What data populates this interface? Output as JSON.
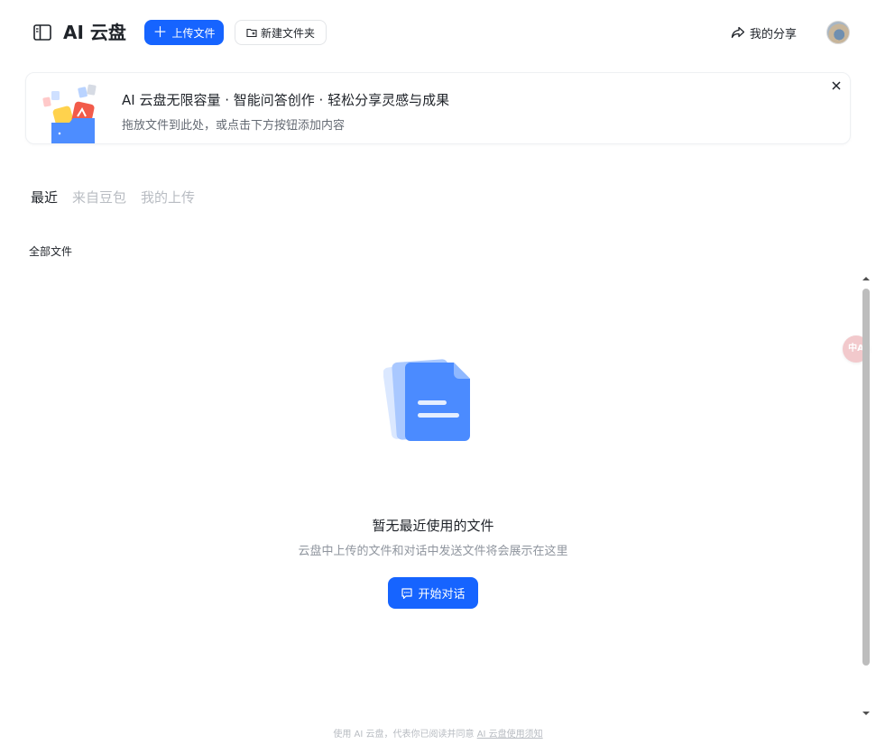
{
  "header": {
    "app_title": "AI 云盘",
    "upload_label": "上传文件",
    "new_folder_label": "新建文件夹",
    "share_label": "我的分享"
  },
  "banner": {
    "title": "AI 云盘无限容量 · 智能问答创作 · 轻松分享灵感与成果",
    "subtitle": "拖放文件到此处，或点击下方按钮添加内容"
  },
  "tabs": [
    {
      "label": "最近",
      "active": true
    },
    {
      "label": "来自豆包",
      "active": false
    },
    {
      "label": "我的上传",
      "active": false
    }
  ],
  "section_label": "全部文件",
  "empty_state": {
    "title": "暂无最近使用的文件",
    "subtitle": "云盘中上传的文件和对话中发送文件将会展示在这里",
    "button_label": "开始对话"
  },
  "translate_badge": "中A",
  "footer": {
    "text": "使用 AI 云盘，代表你已阅读并同意",
    "link": "AI 云盘使用须知"
  },
  "colors": {
    "accent": "#1664ff",
    "text_primary": "#1f2329",
    "text_secondary": "#646a73",
    "text_muted": "#b8bcc2"
  },
  "icons": [
    "sidebar-toggle-icon",
    "plus-icon",
    "folder-add-icon",
    "share-icon",
    "close-icon",
    "document-icon",
    "chat-icon"
  ]
}
